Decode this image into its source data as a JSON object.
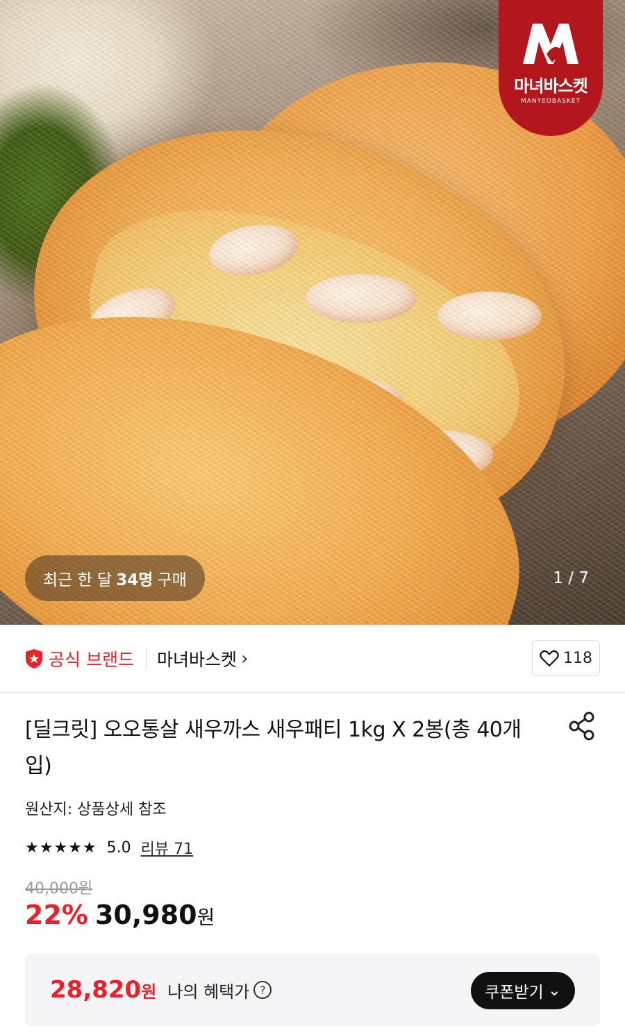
{
  "hero": {
    "image_alt": "새우까스 product photo",
    "badge_text": "마녀바스켓",
    "badge_sub": "MANYEOBASKET",
    "recent_prefix": "최근 한 달",
    "recent_count": "34명",
    "recent_suffix": "구매",
    "page_indicator": "1 / 7"
  },
  "brand": {
    "official_label": "공식 브랜드",
    "store_name": "마녀바스켓",
    "like_count": "118"
  },
  "product": {
    "title": "[딜크릿] 오오통살 새우까스 새우패티 1kg X 2봉(총 40개입)",
    "origin": "원산지: 상품상세 참조",
    "stars": "★★★★★",
    "rating": "5.0",
    "review_label": "리뷰 71",
    "original_price": "40,000원",
    "discount": "22%",
    "price": "30,980",
    "price_unit": "원"
  },
  "benefit": {
    "price": "28,820",
    "unit": "원",
    "label": "나의 혜택가",
    "help": "?",
    "coupon_label": "쿠폰받기",
    "coupon_chevron": "⌄"
  },
  "colors": {
    "accent_red": "#e8212a",
    "badge_red": "#b3171d"
  }
}
